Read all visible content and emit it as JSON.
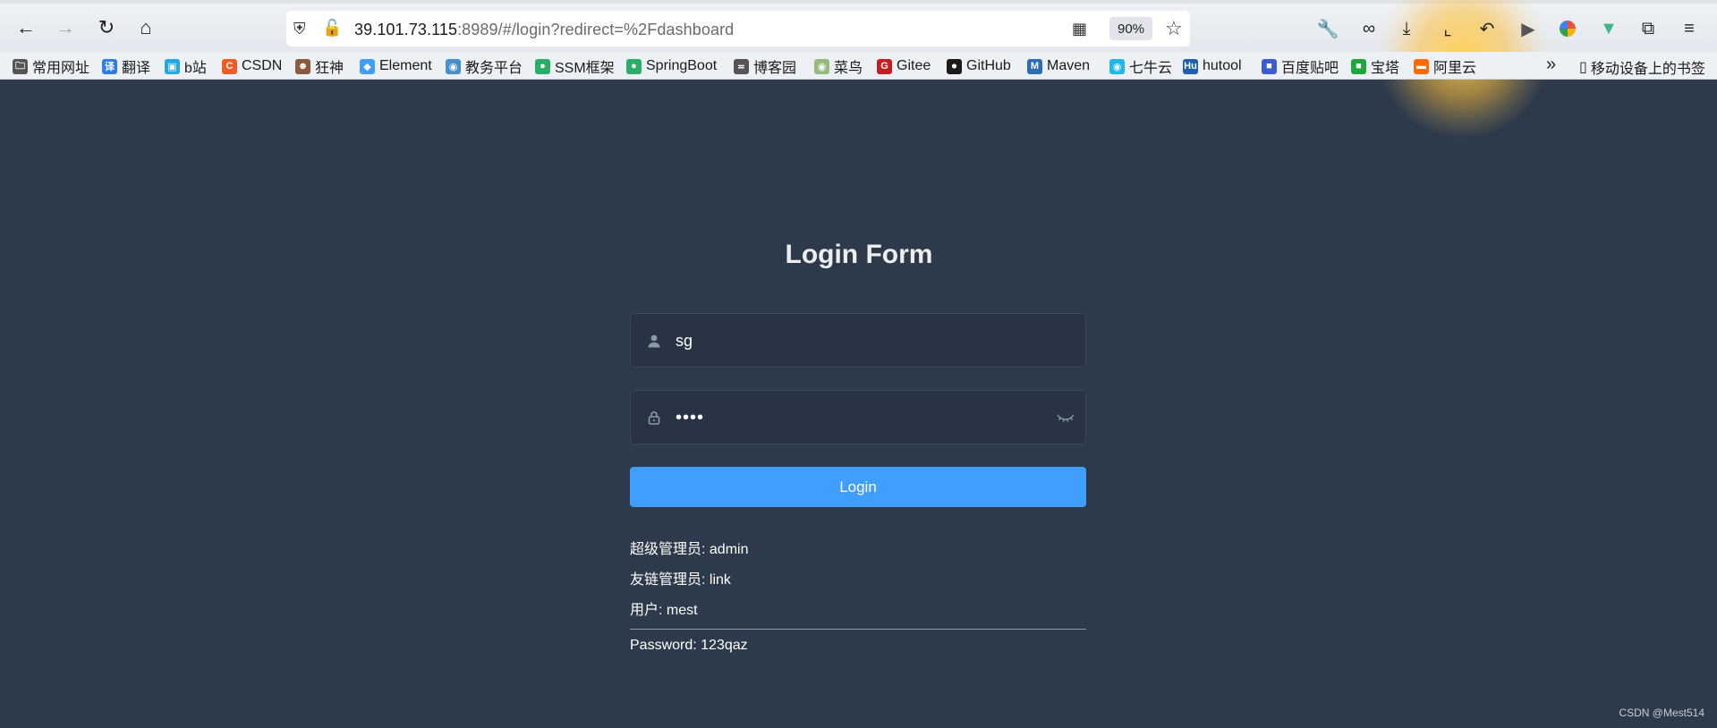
{
  "browser": {
    "url_host": "39.101.73.115",
    "url_path": ":8989/#/login?redirect=%2Fdashboard",
    "zoom": "90%",
    "icons": [
      "back-icon",
      "forward-icon",
      "reload-icon",
      "home-icon",
      "shield-icon",
      "insecure-lock-icon",
      "qr-code-icon",
      "bookmark-star-icon",
      "wrench-icon",
      "mask-icon",
      "download-icon",
      "crop-icon",
      "undo-icon",
      "play-icon",
      "extension-icon",
      "vue-devtools-icon",
      "extensions-puzzle-icon",
      "menu-icon"
    ]
  },
  "bookmarks": {
    "items": [
      {
        "label": "常用网址",
        "icon": "folder-icon",
        "color": "#555555"
      },
      {
        "label": "翻译",
        "icon": "translate-icon",
        "color": "#2b7de9"
      },
      {
        "label": "b站",
        "icon": "bilibili-icon",
        "color": "#23a6e3"
      },
      {
        "label": "CSDN",
        "icon": "csdn-icon",
        "color": "#f15c22"
      },
      {
        "label": "狂神",
        "icon": "kuangshen-avatar-icon",
        "color": "#8a5a3c"
      },
      {
        "label": "Element",
        "icon": "element-icon",
        "color": "#409eff"
      },
      {
        "label": "教务平台",
        "icon": "school-icon",
        "color": "#4a90c8"
      },
      {
        "label": "SSM框架",
        "icon": "wechat-icon",
        "color": "#2aae67"
      },
      {
        "label": "SpringBoot",
        "icon": "wechat-icon",
        "color": "#2aae67"
      },
      {
        "label": "博客园",
        "icon": "cnblogs-icon",
        "color": "#555555"
      },
      {
        "label": "菜鸟",
        "icon": "runoob-icon",
        "color": "#96b97d"
      },
      {
        "label": "Gitee",
        "icon": "gitee-icon",
        "color": "#c71d23"
      },
      {
        "label": "GitHub",
        "icon": "github-icon",
        "color": "#1a1a1a"
      },
      {
        "label": "Maven",
        "icon": "maven-icon",
        "color": "#2d6db5"
      },
      {
        "label": "七牛云",
        "icon": "qiniu-icon",
        "color": "#1fb6e8"
      },
      {
        "label": "hutool",
        "icon": "hutool-icon",
        "color": "#1f5fae"
      },
      {
        "label": "百度贴吧",
        "icon": "tieba-icon",
        "color": "#3d5ccf"
      },
      {
        "label": "宝塔",
        "icon": "baota-icon",
        "color": "#20a53a"
      },
      {
        "label": "阿里云",
        "icon": "aliyun-icon",
        "color": "#ff6a00"
      }
    ],
    "mobile_label": "移动设备上的书签"
  },
  "login": {
    "title": "Login Form",
    "username_value": "sg",
    "password_value": "••••",
    "button_label": "Login",
    "tips": [
      "超级管理员: admin",
      "友链管理员: link",
      "用户: mest"
    ],
    "password_tip": "Password: 123qaz"
  },
  "watermark": "CSDN @Mest514",
  "colors": {
    "background": "#2d3a4b",
    "input_bg": "#283443",
    "accent": "#409eff"
  }
}
